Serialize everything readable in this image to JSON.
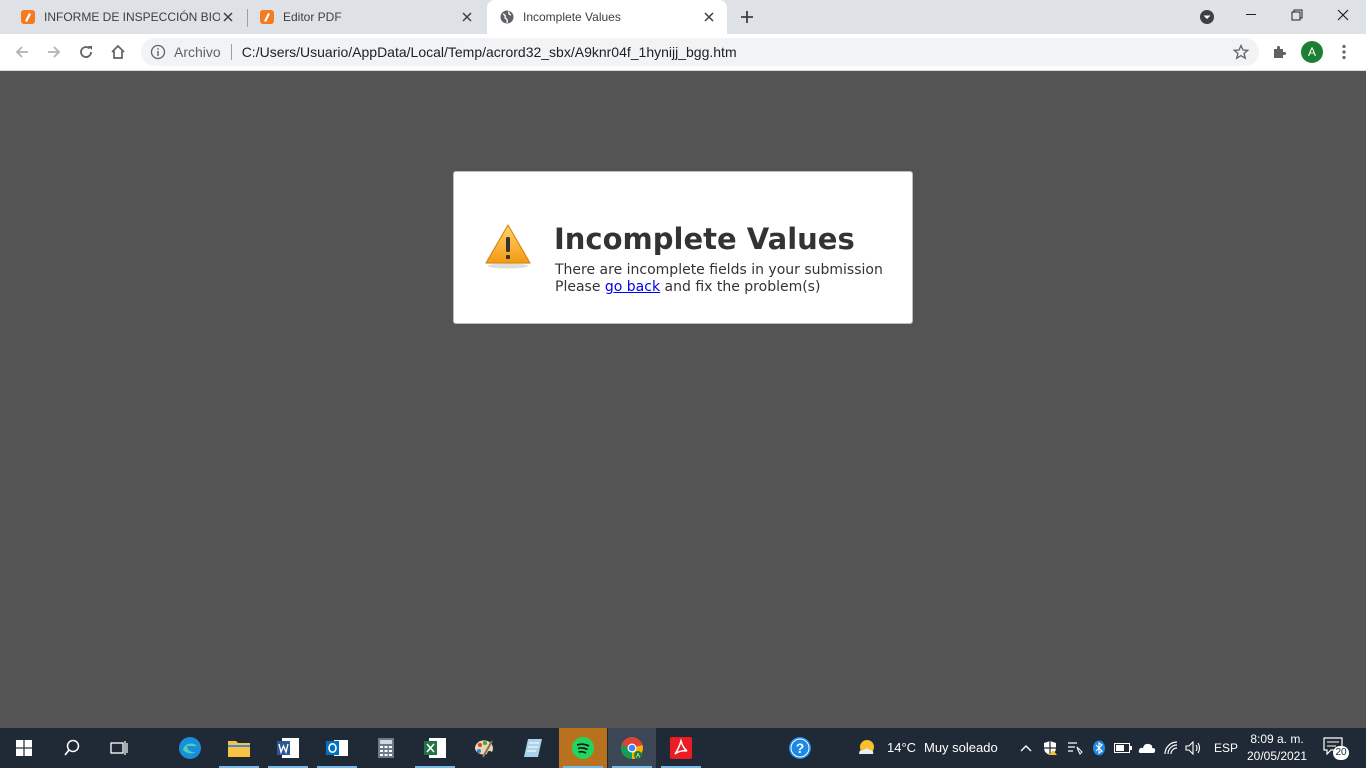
{
  "tabs": [
    {
      "title": "INFORME DE INSPECCIÓN BIOSE",
      "favicon": "pdf-editor-icon"
    },
    {
      "title": "Editor PDF",
      "favicon": "pdf-editor-icon"
    },
    {
      "title": "Incomplete Values",
      "favicon": "globe-icon",
      "active": true
    }
  ],
  "toolbar": {
    "scheme_label": "Archivo",
    "url": "C:/Users/Usuario/AppData/Local/Temp/acrord32_sbx/A9knr04f_1hynijj_bgg.htm",
    "profile_initial": "A"
  },
  "dialog": {
    "title": "Incomplete Values",
    "line1": "There are incomplete fields in your submission",
    "line2_prefix": "Please ",
    "link": "go back",
    "line2_suffix": " and fix the problem(s)"
  },
  "taskbar": {
    "weather_temp": "14°C",
    "weather_desc": "Muy soleado",
    "language": "ESP",
    "time": "8:09 a. m.",
    "date": "20/05/2021",
    "notifications": "20"
  },
  "colors": {
    "page_bg": "#545454",
    "tabstrip_bg": "#dee1e6",
    "taskbar_bg": "#1f2a36",
    "link": "#0000ee"
  }
}
